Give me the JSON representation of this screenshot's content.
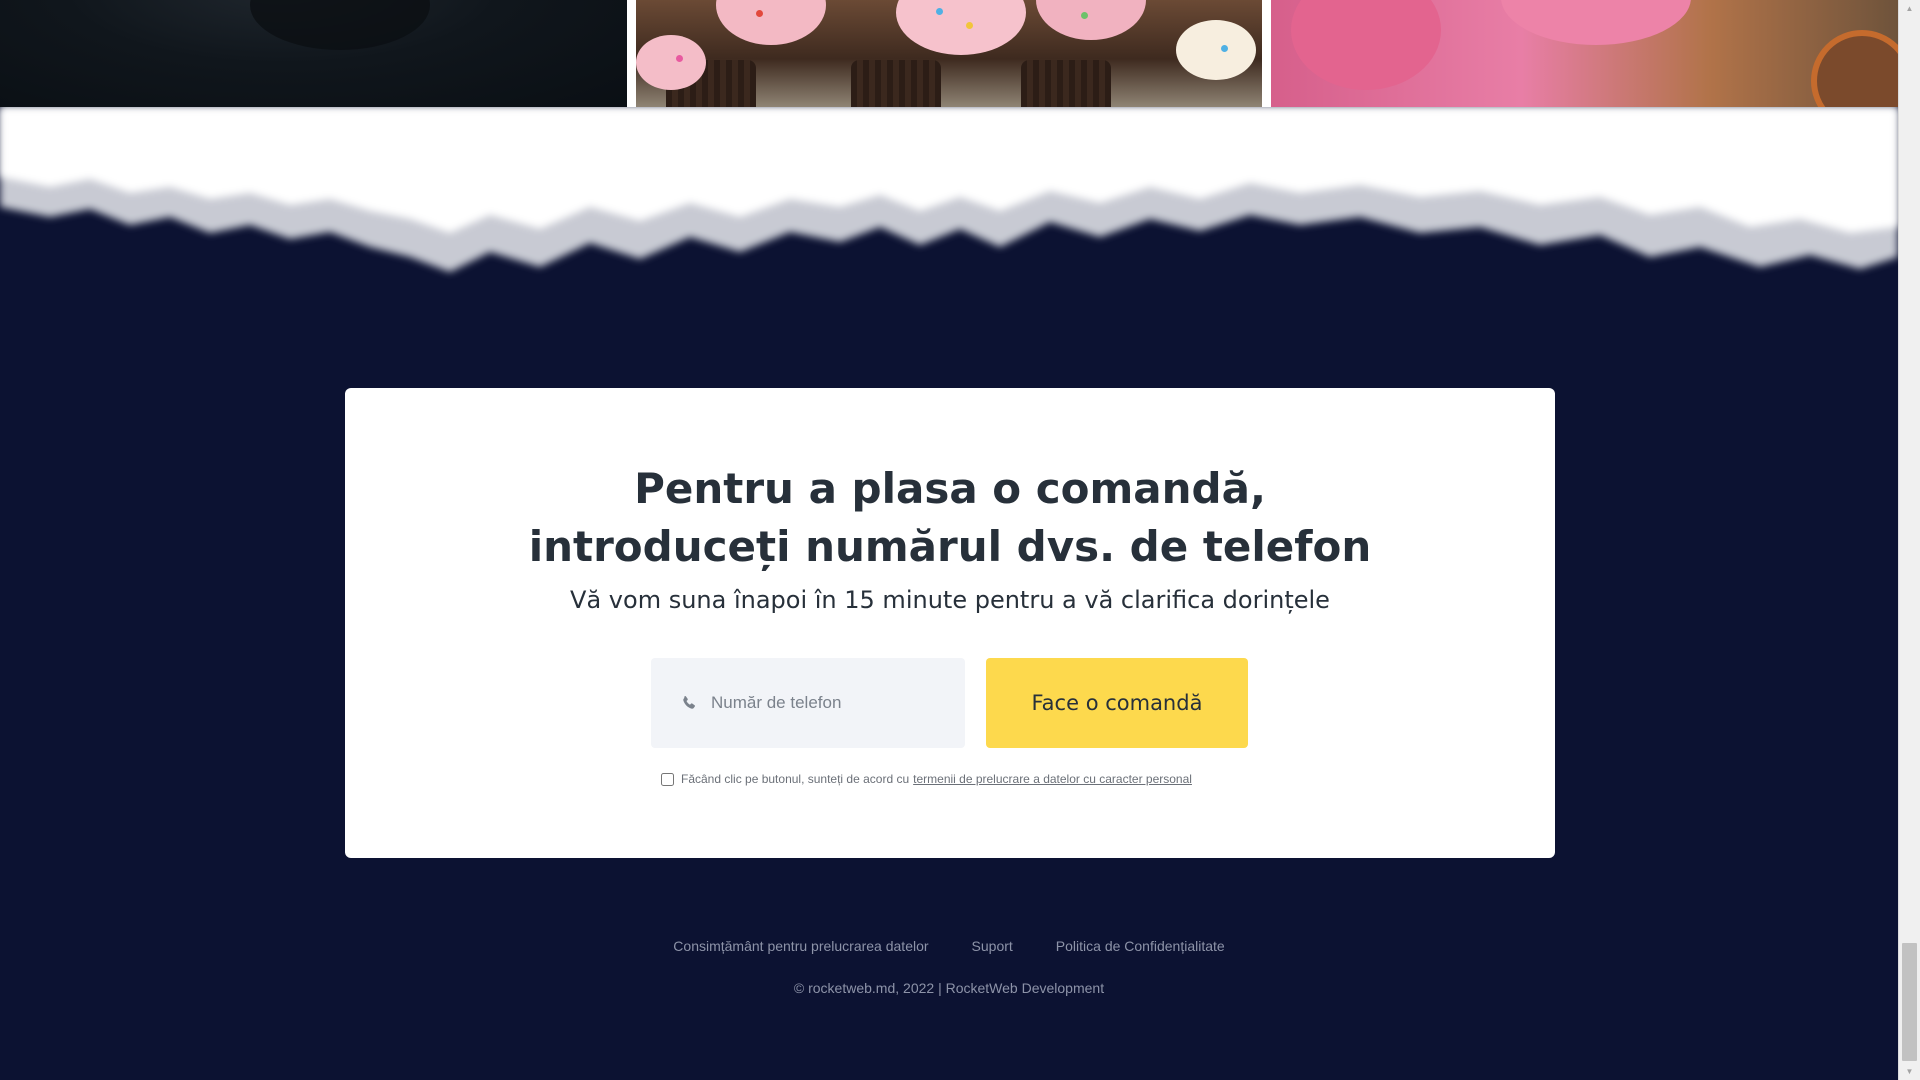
{
  "gallery": {
    "images": [
      {
        "name": "dark dessert photo"
      },
      {
        "name": "chocolate cupcakes photo"
      },
      {
        "name": "pink frosted cupcakes photo"
      }
    ]
  },
  "order_form": {
    "title_line1": "Pentru a plasa o comandă,",
    "title_line2": "introduceți numărul dvs. de telefon",
    "subtitle": "Vă vom suna înapoi în 15 minute pentru a vă clarifica dorințele",
    "phone_placeholder": "Număr de telefon",
    "phone_value": "",
    "phone_icon": "phone-icon",
    "submit_label": "Face o comandă",
    "consent_text": "Făcând clic pe butonul, sunteți de acord cu",
    "consent_link": "termenii de prelucrare a datelor cu caracter personal",
    "consent_checked": false
  },
  "footer": {
    "links": [
      {
        "label": "Consimțământ pentru prelucrarea datelor"
      },
      {
        "label": "Suport"
      },
      {
        "label": "Politica de Confidențialitate"
      }
    ],
    "copyright": "© rocketweb.md, 2022 | RocketWeb Development"
  },
  "colors": {
    "background": "#0c1232",
    "card": "#ffffff",
    "accent_button": "#fdd94d",
    "input_bg": "#f2f4f8",
    "heading_text": "#27303a",
    "footer_text": "#8d93a8"
  }
}
